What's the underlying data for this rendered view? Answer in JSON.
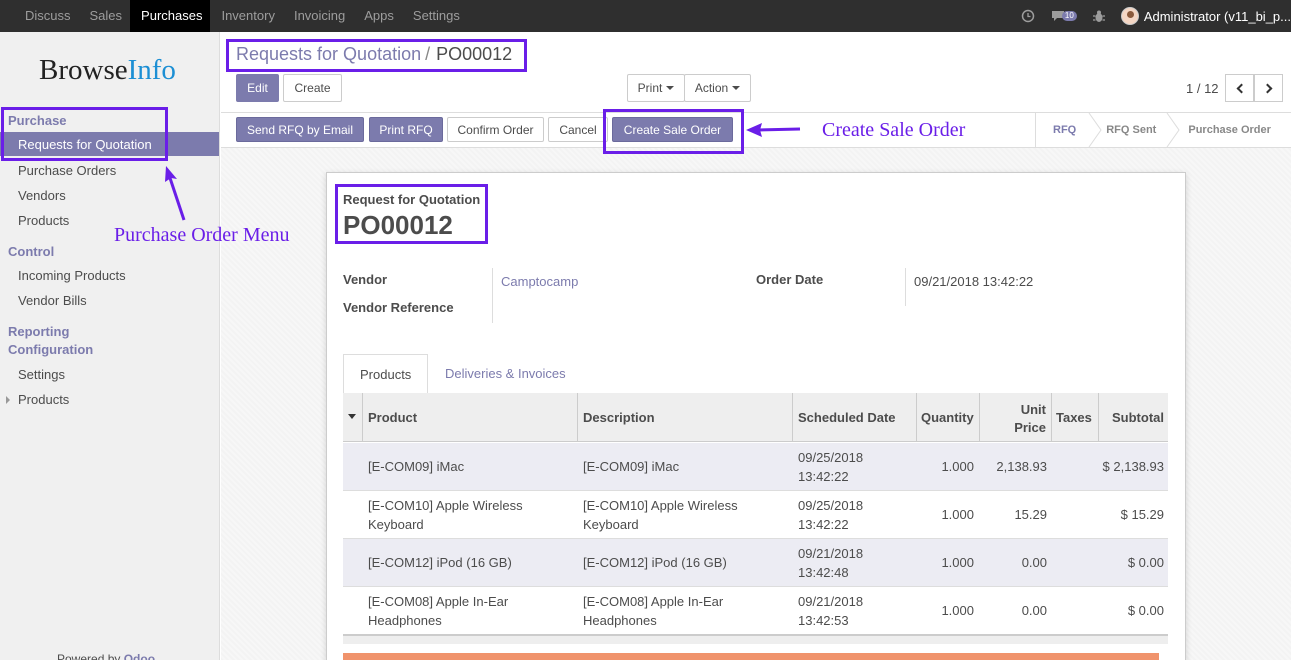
{
  "topbar": {
    "menu": [
      "Discuss",
      "Sales",
      "Purchases",
      "Inventory",
      "Invoicing",
      "Apps",
      "Settings"
    ],
    "active_menu": "Purchases",
    "messages_badge": "10",
    "user": "Administrator (v11_bi_p..."
  },
  "sidebar": {
    "logo_a": "Browse",
    "logo_b": "Info",
    "sections": {
      "purchase": "Purchase",
      "control": "Control",
      "reporting": "Reporting",
      "configuration": "Configuration"
    },
    "items": {
      "rfq": "Requests for Quotation",
      "purchase_orders": "Purchase Orders",
      "vendors": "Vendors",
      "products": "Products",
      "incoming_products": "Incoming Products",
      "vendor_bills": "Vendor Bills",
      "settings": "Settings",
      "config_products": "Products"
    },
    "powered_prefix": "Powered by",
    "powered_brand": "Odoo"
  },
  "breadcrumb": {
    "parent": "Requests for Quotation",
    "separator": "/",
    "current": "PO00012"
  },
  "toolbar": {
    "edit": "Edit",
    "create": "Create",
    "print": "Print",
    "action": "Action"
  },
  "pager": {
    "value": "1 / 12"
  },
  "actions": {
    "send_rfq": "Send RFQ by Email",
    "print_rfq": "Print RFQ",
    "confirm": "Confirm Order",
    "cancel": "Cancel",
    "create_sale_order": "Create Sale Order"
  },
  "statusbar": [
    "RFQ",
    "RFQ Sent",
    "Purchase Order"
  ],
  "form": {
    "title_label": "Request for Quotation",
    "name": "PO00012",
    "vendor_label": "Vendor",
    "vendor_value": "Camptocamp",
    "vendor_ref_label": "Vendor Reference",
    "order_date_label": "Order Date",
    "order_date_value": "09/21/2018 13:42:22"
  },
  "tabs": {
    "products": "Products",
    "deliveries": "Deliveries & Invoices"
  },
  "table": {
    "headers": {
      "product": "Product",
      "description": "Description",
      "scheduled": "Scheduled Date",
      "quantity": "Quantity",
      "unit_price_1": "Unit",
      "unit_price_2": "Price",
      "taxes": "Taxes",
      "subtotal": "Subtotal"
    },
    "rows": [
      {
        "product_1": "[E-COM09] iMac",
        "product_2": "",
        "desc_1": "[E-COM09] iMac",
        "desc_2": "",
        "date_1": "09/25/2018",
        "date_2": "13:42:22",
        "qty": "1.000",
        "price": "2,138.93",
        "taxes": "",
        "subtotal": "$ 2,138.93"
      },
      {
        "product_1": "[E-COM10] Apple Wireless",
        "product_2": "Keyboard",
        "desc_1": "[E-COM10] Apple Wireless",
        "desc_2": "Keyboard",
        "date_1": "09/25/2018",
        "date_2": "13:42:22",
        "qty": "1.000",
        "price": "15.29",
        "taxes": "",
        "subtotal": "$ 15.29"
      },
      {
        "product_1": "[E-COM12] iPod (16 GB)",
        "product_2": "",
        "desc_1": "[E-COM12] iPod (16 GB)",
        "desc_2": "",
        "date_1": "09/21/2018",
        "date_2": "13:42:48",
        "qty": "1.000",
        "price": "0.00",
        "taxes": "",
        "subtotal": "$ 0.00"
      },
      {
        "product_1": "[E-COM08] Apple In-Ear",
        "product_2": "Headphones",
        "desc_1": "[E-COM08] Apple In-Ear",
        "desc_2": "Headphones",
        "date_1": "09/21/2018",
        "date_2": "13:42:53",
        "qty": "1.000",
        "price": "0.00",
        "taxes": "",
        "subtotal": "$ 0.00"
      }
    ]
  },
  "annotations": {
    "create_sale_order": "Create Sale Order",
    "purchase_order_menu": "Purchase Order Menu"
  },
  "colors": {
    "brand": "#7c7bad",
    "annotation": "#6a1ee8",
    "navbar": "#2f2f2f"
  }
}
